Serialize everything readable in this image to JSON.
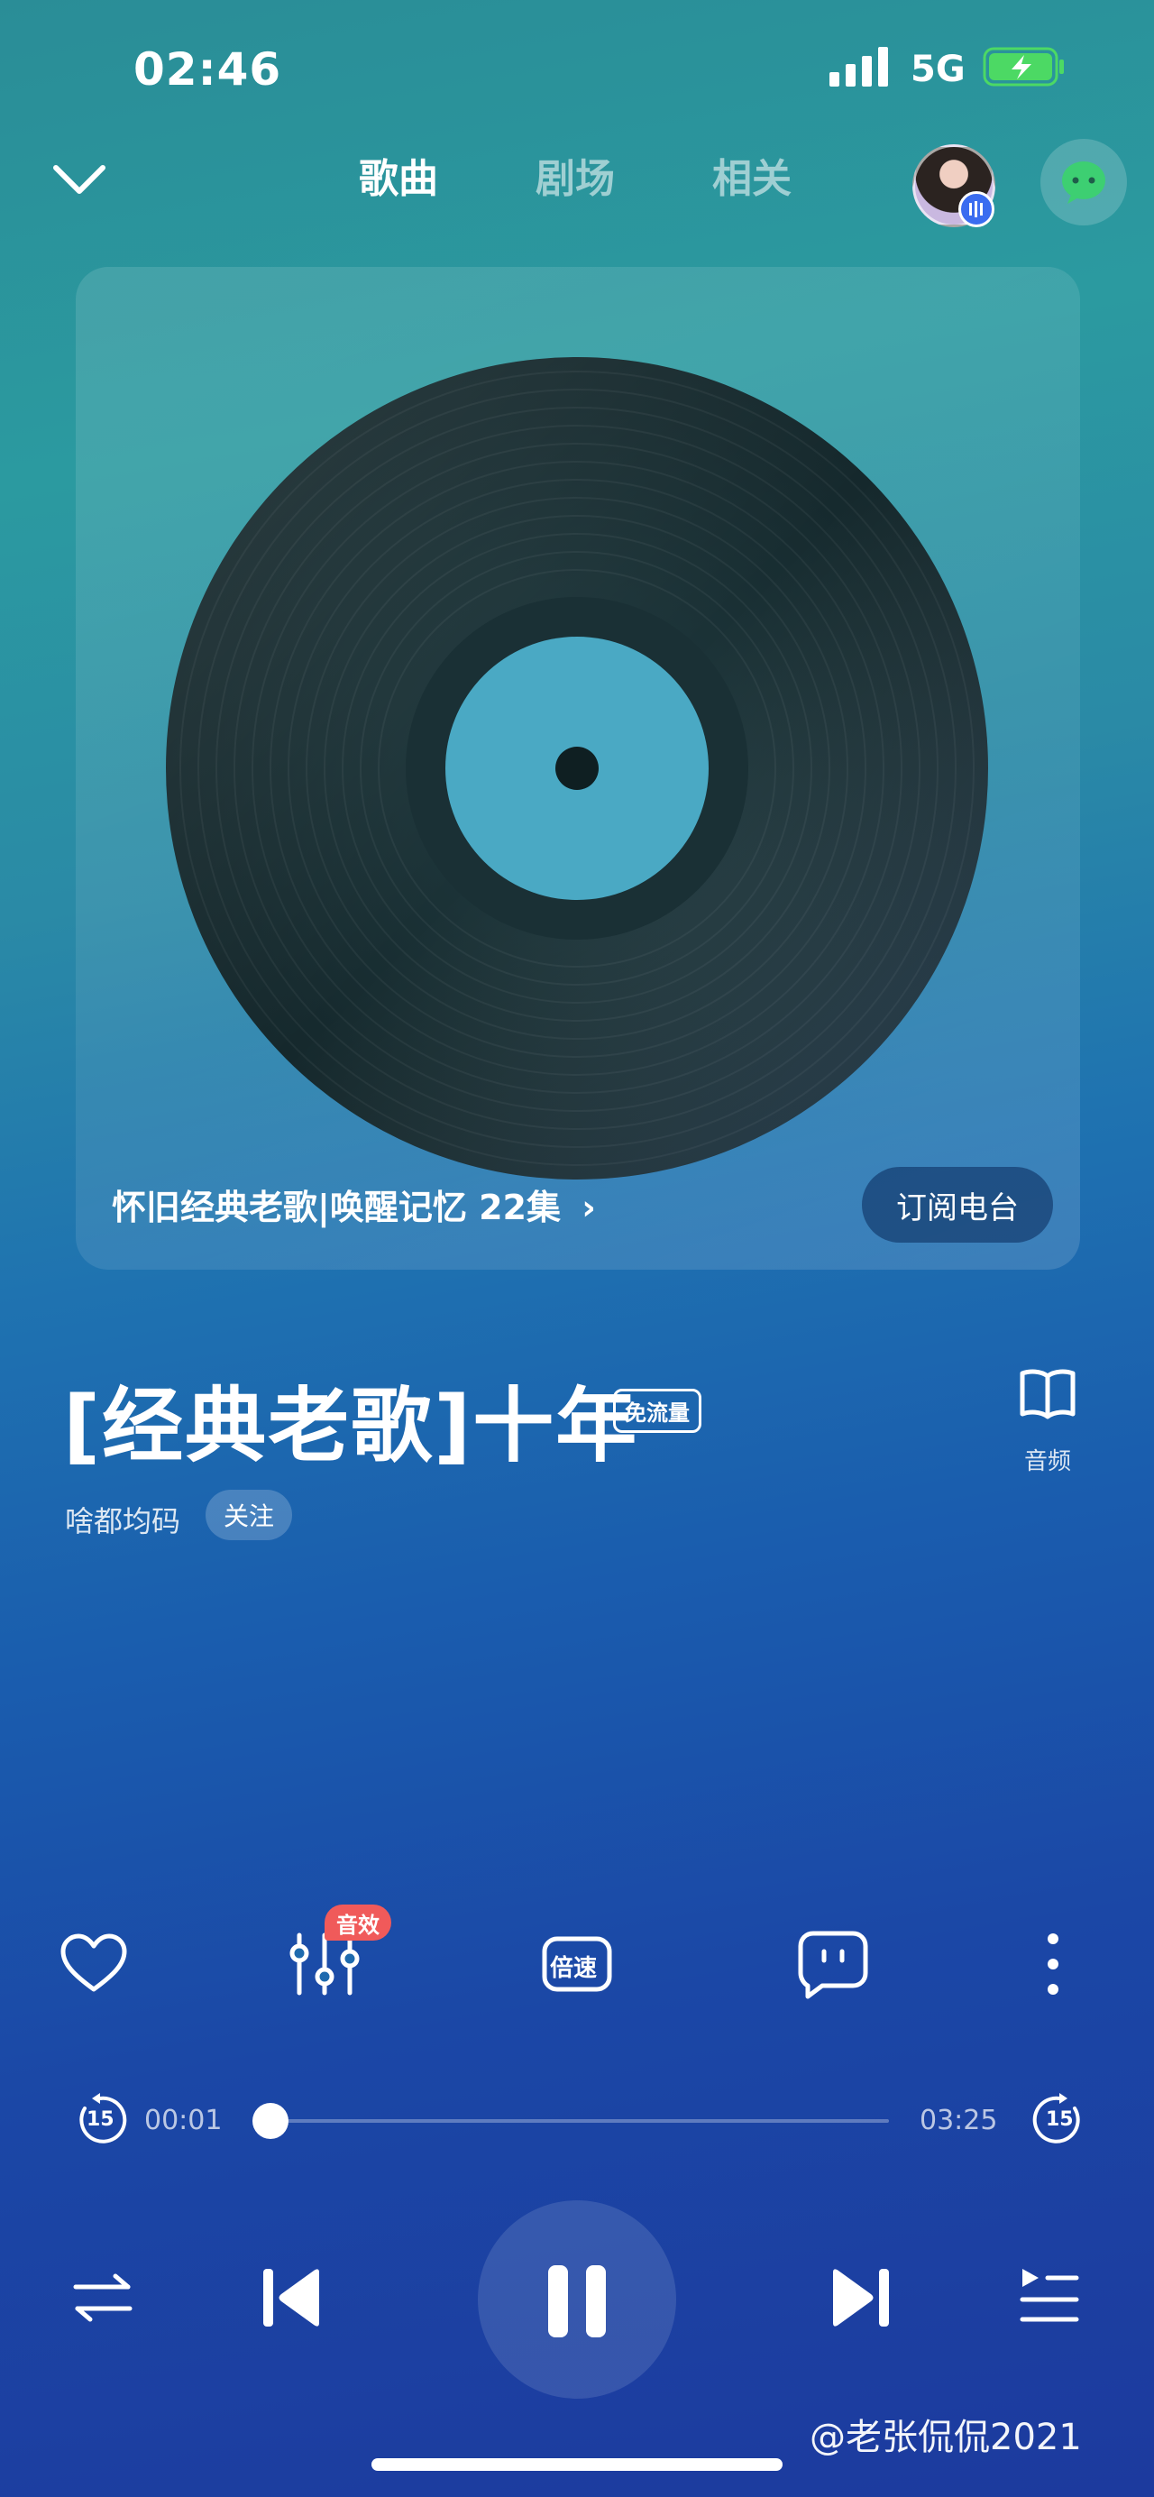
{
  "status_bar": {
    "time": "02:46",
    "network": "5G",
    "battery_icon": "battery-charging-icon",
    "signal_icon": "signal-icon"
  },
  "top_nav": {
    "back_icon": "chevron-down-icon",
    "tabs": [
      {
        "label": "歌曲",
        "active": true
      },
      {
        "label": "剧场",
        "active": false
      },
      {
        "label": "相关",
        "active": false
      }
    ],
    "chat_icon": "chat-bubble-icon"
  },
  "album": {
    "title": "怀旧经典老歌|唤醒记忆 22集",
    "subscribe_label": "订阅电台"
  },
  "song": {
    "title": "[经典老歌]十年",
    "free_badge": "免流量",
    "audio_label": "音频",
    "artist": "啥都均码",
    "follow_label": "关注"
  },
  "actions": {
    "eq_badge": "音效",
    "speed_label": "倍速"
  },
  "progress": {
    "current": "00:01",
    "total": "03:25",
    "fraction": 0.005,
    "skip_seconds": "15"
  },
  "colors": {
    "accent_red": "#f05a5a",
    "battery_green": "#4cd964",
    "chat_green": "#3dcf72"
  },
  "watermark": "@老张侃侃2021"
}
